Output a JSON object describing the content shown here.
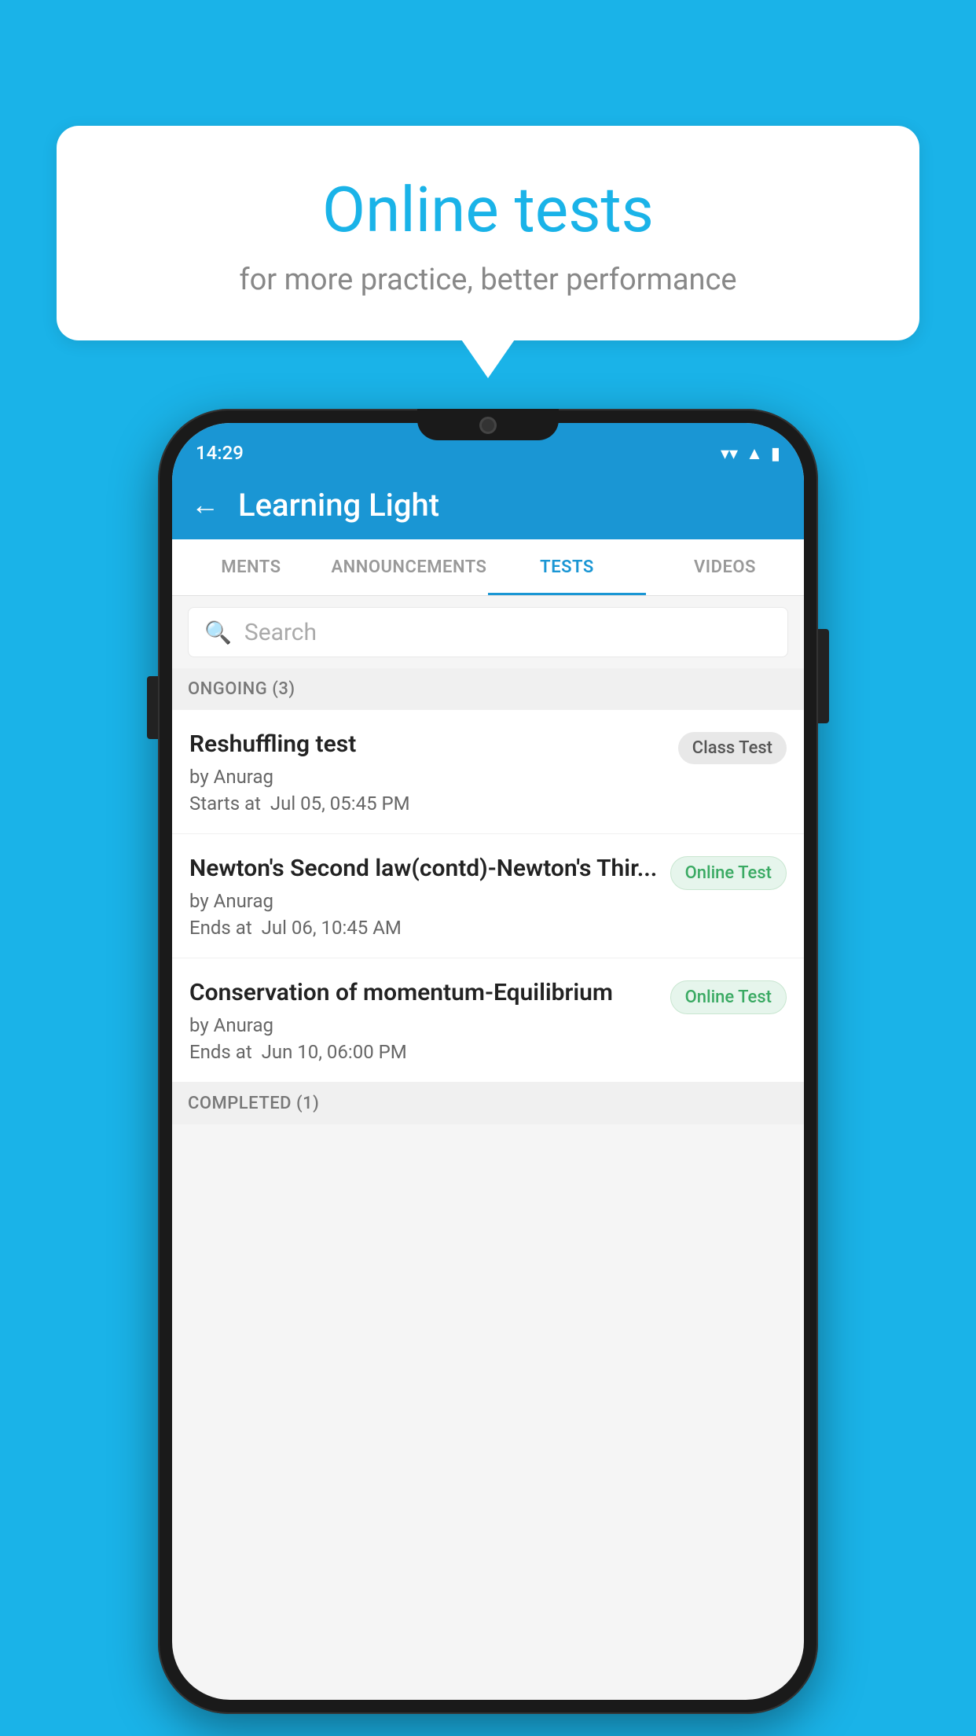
{
  "background_color": "#1ab3e8",
  "speech_bubble": {
    "title": "Online tests",
    "subtitle": "for more practice, better performance"
  },
  "phone": {
    "status_bar": {
      "time": "14:29",
      "wifi": "▼",
      "signal": "▲",
      "battery": "▮"
    },
    "header": {
      "back_label": "←",
      "title": "Learning Light"
    },
    "tabs": [
      {
        "label": "MENTS",
        "active": false
      },
      {
        "label": "ANNOUNCEMENTS",
        "active": false
      },
      {
        "label": "TESTS",
        "active": true
      },
      {
        "label": "VIDEOS",
        "active": false
      }
    ],
    "search": {
      "placeholder": "Search"
    },
    "ongoing_section": {
      "label": "ONGOING (3)"
    },
    "tests": [
      {
        "name": "Reshuffling test",
        "author": "by Anurag",
        "time_label": "Starts at",
        "time_value": "Jul 05, 05:45 PM",
        "badge": "Class Test",
        "badge_type": "class"
      },
      {
        "name": "Newton's Second law(contd)-Newton's Thir...",
        "author": "by Anurag",
        "time_label": "Ends at",
        "time_value": "Jul 06, 10:45 AM",
        "badge": "Online Test",
        "badge_type": "online"
      },
      {
        "name": "Conservation of momentum-Equilibrium",
        "author": "by Anurag",
        "time_label": "Ends at",
        "time_value": "Jun 10, 06:00 PM",
        "badge": "Online Test",
        "badge_type": "online"
      }
    ],
    "completed_section": {
      "label": "COMPLETED (1)"
    }
  }
}
